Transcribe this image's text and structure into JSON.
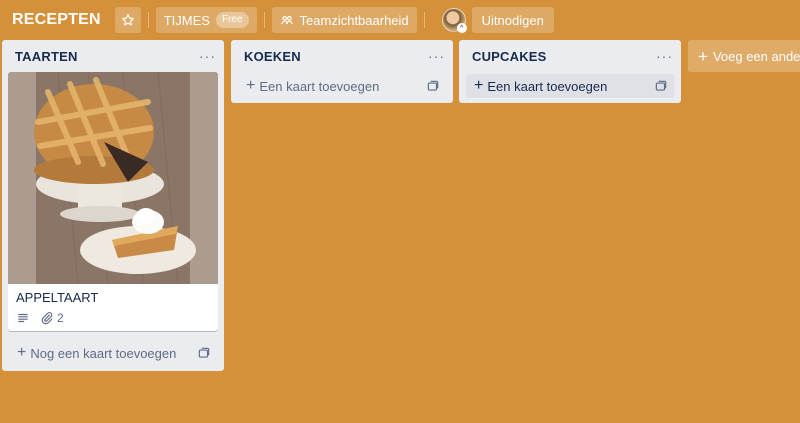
{
  "header": {
    "board_title": "RECEPTEN",
    "workspace_name": "TIJMES",
    "workspace_badge": "Free",
    "visibility_label": "Teamzichtbaarheid",
    "invite_label": "Uitnodigen"
  },
  "lists": [
    {
      "title": "TAARTEN",
      "menu": "···",
      "cards": [
        {
          "title": "APPELTAART",
          "attachments": "2"
        }
      ],
      "add_card_label": "Nog een kaart toevoegen"
    },
    {
      "title": "KOEKEN",
      "menu": "···",
      "add_card_label": "Een kaart toevoegen"
    },
    {
      "title": "CUPCAKES",
      "menu": "···",
      "add_card_label": "Een kaart toevoegen"
    }
  ],
  "add_list_label": "Voeg een andere lijst toe",
  "colors": {
    "board_background": "#d4913a",
    "list_background": "#ebecf0"
  }
}
